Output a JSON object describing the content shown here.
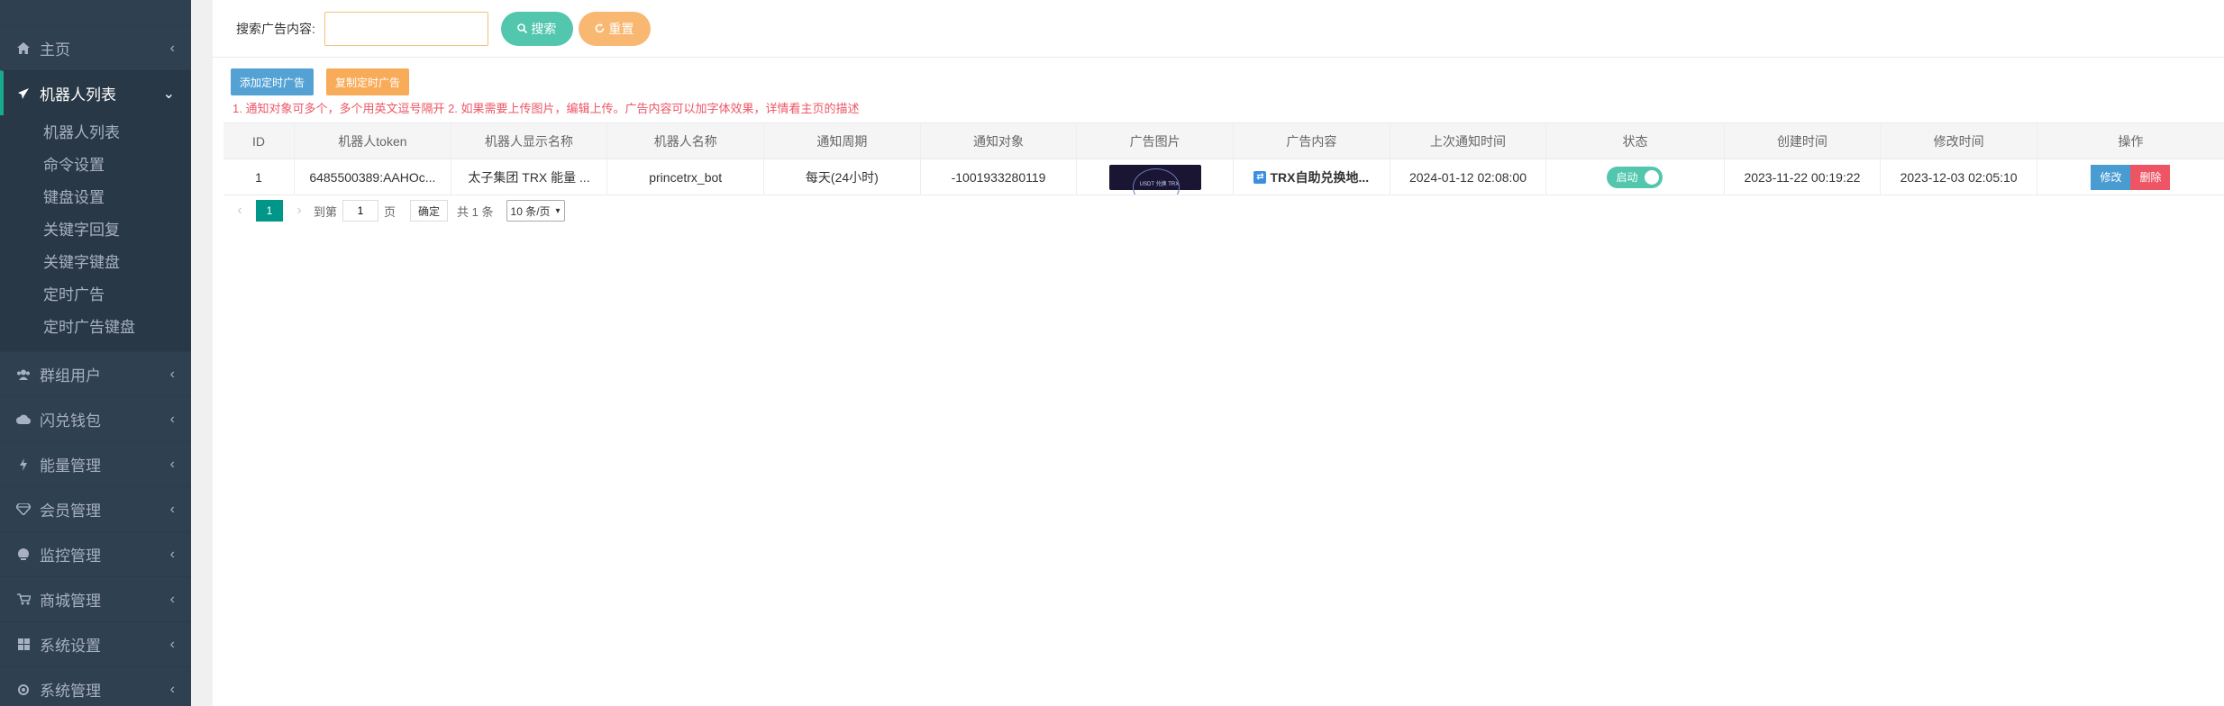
{
  "sidebar": {
    "items": [
      {
        "label": "主页",
        "icon": "home-icon"
      },
      {
        "label": "机器人列表",
        "icon": "plane-icon",
        "active": true
      },
      {
        "label": "群组用户",
        "icon": "users-icon"
      },
      {
        "label": "闪兑钱包",
        "icon": "cloud-icon"
      },
      {
        "label": "能量管理",
        "icon": "bolt-icon"
      },
      {
        "label": "会员管理",
        "icon": "diamond-icon"
      },
      {
        "label": "监控管理",
        "icon": "monitor-icon"
      },
      {
        "label": "商城管理",
        "icon": "cart-icon"
      },
      {
        "label": "系统设置",
        "icon": "windows-icon"
      },
      {
        "label": "系统管理",
        "icon": "gear-icon"
      }
    ],
    "submenu": [
      "机器人列表",
      "命令设置",
      "键盘设置",
      "关键字回复",
      "关键字键盘",
      "定时广告",
      "定时广告键盘"
    ]
  },
  "search": {
    "label": "搜索广告内容:",
    "placeholder": "",
    "search_btn": "搜索",
    "reset_btn": "重置"
  },
  "toolbar": {
    "add_label": "添加定时广告",
    "copy_label": "复制定时广告",
    "notice": "1. 通知对象可多个，多个用英文逗号隔开 2. 如果需要上传图片，编辑上传。广告内容可以加字体效果，详情看主页的描述"
  },
  "table": {
    "headers": [
      "ID",
      "机器人token",
      "机器人显示名称",
      "机器人名称",
      "通知周期",
      "通知对象",
      "广告图片",
      "广告内容",
      "上次通知时间",
      "状态",
      "创建时间",
      "修改时间",
      "操作"
    ],
    "rows": [
      {
        "id": "1",
        "token": "6485500389:AAHOc...",
        "display_name": "太子集团 TRX 能量 ...",
        "name": "princetrx_bot",
        "cycle": "每天(24小时)",
        "target": "-1001933280119",
        "image_caption": "USDT 兑换 TRX",
        "content": "TRX自助兑换地...",
        "last_notify": "2024-01-12 02:08:00",
        "status": "启动",
        "created": "2023-11-22 00:19:22",
        "modified": "2023-12-03 02:05:10",
        "edit_label": "修改",
        "delete_label": "删除"
      }
    ]
  },
  "pager": {
    "current": "1",
    "goto_label": "到第",
    "goto_value": "1",
    "page_unit": "页",
    "ok_label": "确定",
    "total": "共 1 条",
    "size_option": "10 条/页"
  },
  "colors": {
    "sidebar_bg": "#2f4050",
    "primary": "#1ab394",
    "warning": "#f8ac59",
    "info": "#1c84c6",
    "danger": "#ed5565",
    "pager_active": "#009688"
  }
}
